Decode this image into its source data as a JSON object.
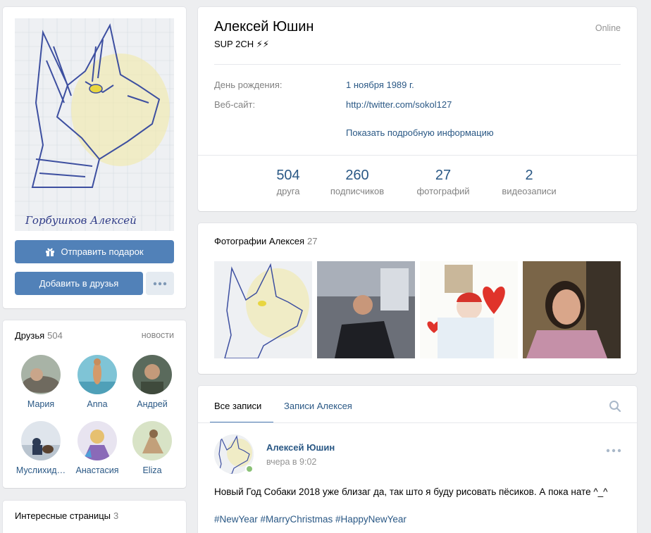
{
  "profile": {
    "name": "Алексей Юшин",
    "status": "SUP 2CH ⚡⚡",
    "online": "Online",
    "birthday_label": "День рождения:",
    "birthday_value": "1 ноября 1989 г.",
    "website_label": "Веб-сайт:",
    "website_value": "http://twitter.com/sokol127",
    "more_info": "Показать подробную информацию"
  },
  "stats": [
    {
      "n": "504",
      "label": "друга"
    },
    {
      "n": "260",
      "label": "подписчиков"
    },
    {
      "n": "27",
      "label": "фотографий"
    },
    {
      "n": "2",
      "label": "видеозаписи"
    }
  ],
  "actions": {
    "gift": "Отправить подарок",
    "add_friend": "Добавить в друзья"
  },
  "avatar_signature": "Горбушков Алексей",
  "friends": {
    "title": "Друзья",
    "count": "504",
    "news": "новости",
    "items": [
      {
        "name": "Мария"
      },
      {
        "name": "Anna"
      },
      {
        "name": "Андрей"
      },
      {
        "name": "Муслихид…"
      },
      {
        "name": "Анастасия"
      },
      {
        "name": "Eliza"
      }
    ]
  },
  "interest": {
    "title": "Интересные страницы",
    "count": "3"
  },
  "photos": {
    "title": "Фотографии Алексея",
    "count": "27"
  },
  "wall": {
    "tab_all": "Все записи",
    "tab_own": "Записи Алексея",
    "post": {
      "author": "Алексей Юшин",
      "time": "вчера в 9:02",
      "text": "Новый Год Собаки 2018 уже близаг да, так што я буду рисовать пёсиков. А пока нате ^_^",
      "tags": "#NewYear #MarryChristmas #HappyNewYear"
    }
  },
  "colors": {
    "accent": "#5181b8",
    "link": "#2a5885",
    "bg": "#edeef0",
    "online": "#8ac176"
  }
}
